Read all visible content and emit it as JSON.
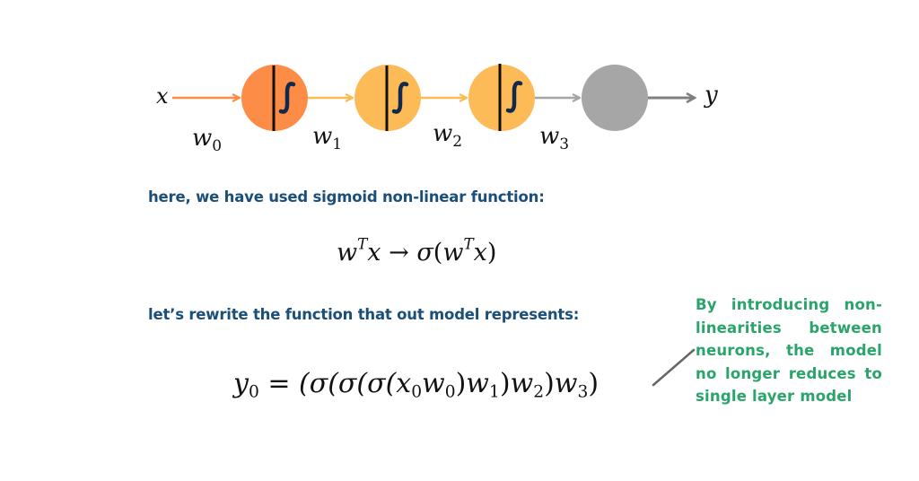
{
  "diagram": {
    "input_label": "x",
    "output_label": "y",
    "neurons": [
      {
        "id": "n1",
        "fill": "#fd8c47",
        "activation": "sigmoid",
        "activation_glyph": "∫"
      },
      {
        "id": "n2",
        "fill": "#fdbb57",
        "activation": "sigmoid",
        "activation_glyph": "∫"
      },
      {
        "id": "n3",
        "fill": "#fdbb57",
        "activation": "sigmoid",
        "activation_glyph": "∫"
      },
      {
        "id": "n4",
        "fill": "#a6a6a6",
        "activation": "none",
        "activation_glyph": ""
      }
    ],
    "weights": [
      {
        "base": "w",
        "sub": "0"
      },
      {
        "base": "w",
        "sub": "1"
      },
      {
        "base": "w",
        "sub": "2"
      },
      {
        "base": "w",
        "sub": "3"
      }
    ],
    "arrow_colors": [
      "#fd8c47",
      "#fdbb57",
      "#fdbb57",
      "#a6a6a6",
      "#7f7f7f"
    ],
    "glyph_color": "#13294b",
    "divider_color": "#111111"
  },
  "captions": {
    "sigmoid_intro": "here, we have used sigmoid non-linear function:",
    "rewrite_intro": "let’s rewrite the function that out model represents:"
  },
  "equations": {
    "sigmoid": {
      "lhs_w": "w",
      "lhs_sup": "T",
      "lhs_x": "x",
      "arrow": "→",
      "sigma": "σ",
      "open": "(",
      "rhs_w": "w",
      "rhs_sup": "T",
      "rhs_x": "x",
      "close": ")"
    },
    "model": {
      "y": "y",
      "y_sub": "0",
      "equals": " = ",
      "body_prefix": "(σ(σ(σ(",
      "x": "x",
      "x_sub": "0",
      "w0": "w",
      "w0_sub": "0",
      "close1": ")",
      "w1": "w",
      "w1_sub": "1",
      "close2": ")",
      "w2": "w",
      "w2_sub": "2",
      "close3": ")",
      "w3": "w",
      "w3_sub": "3",
      "close4": ")"
    }
  },
  "note": {
    "lines": [
      "By introducing non-",
      "linearities between",
      "neurons, the model",
      "no longer reduces to",
      "single layer model"
    ],
    "color": "#2aa46a",
    "pointer_color": "#666666"
  }
}
